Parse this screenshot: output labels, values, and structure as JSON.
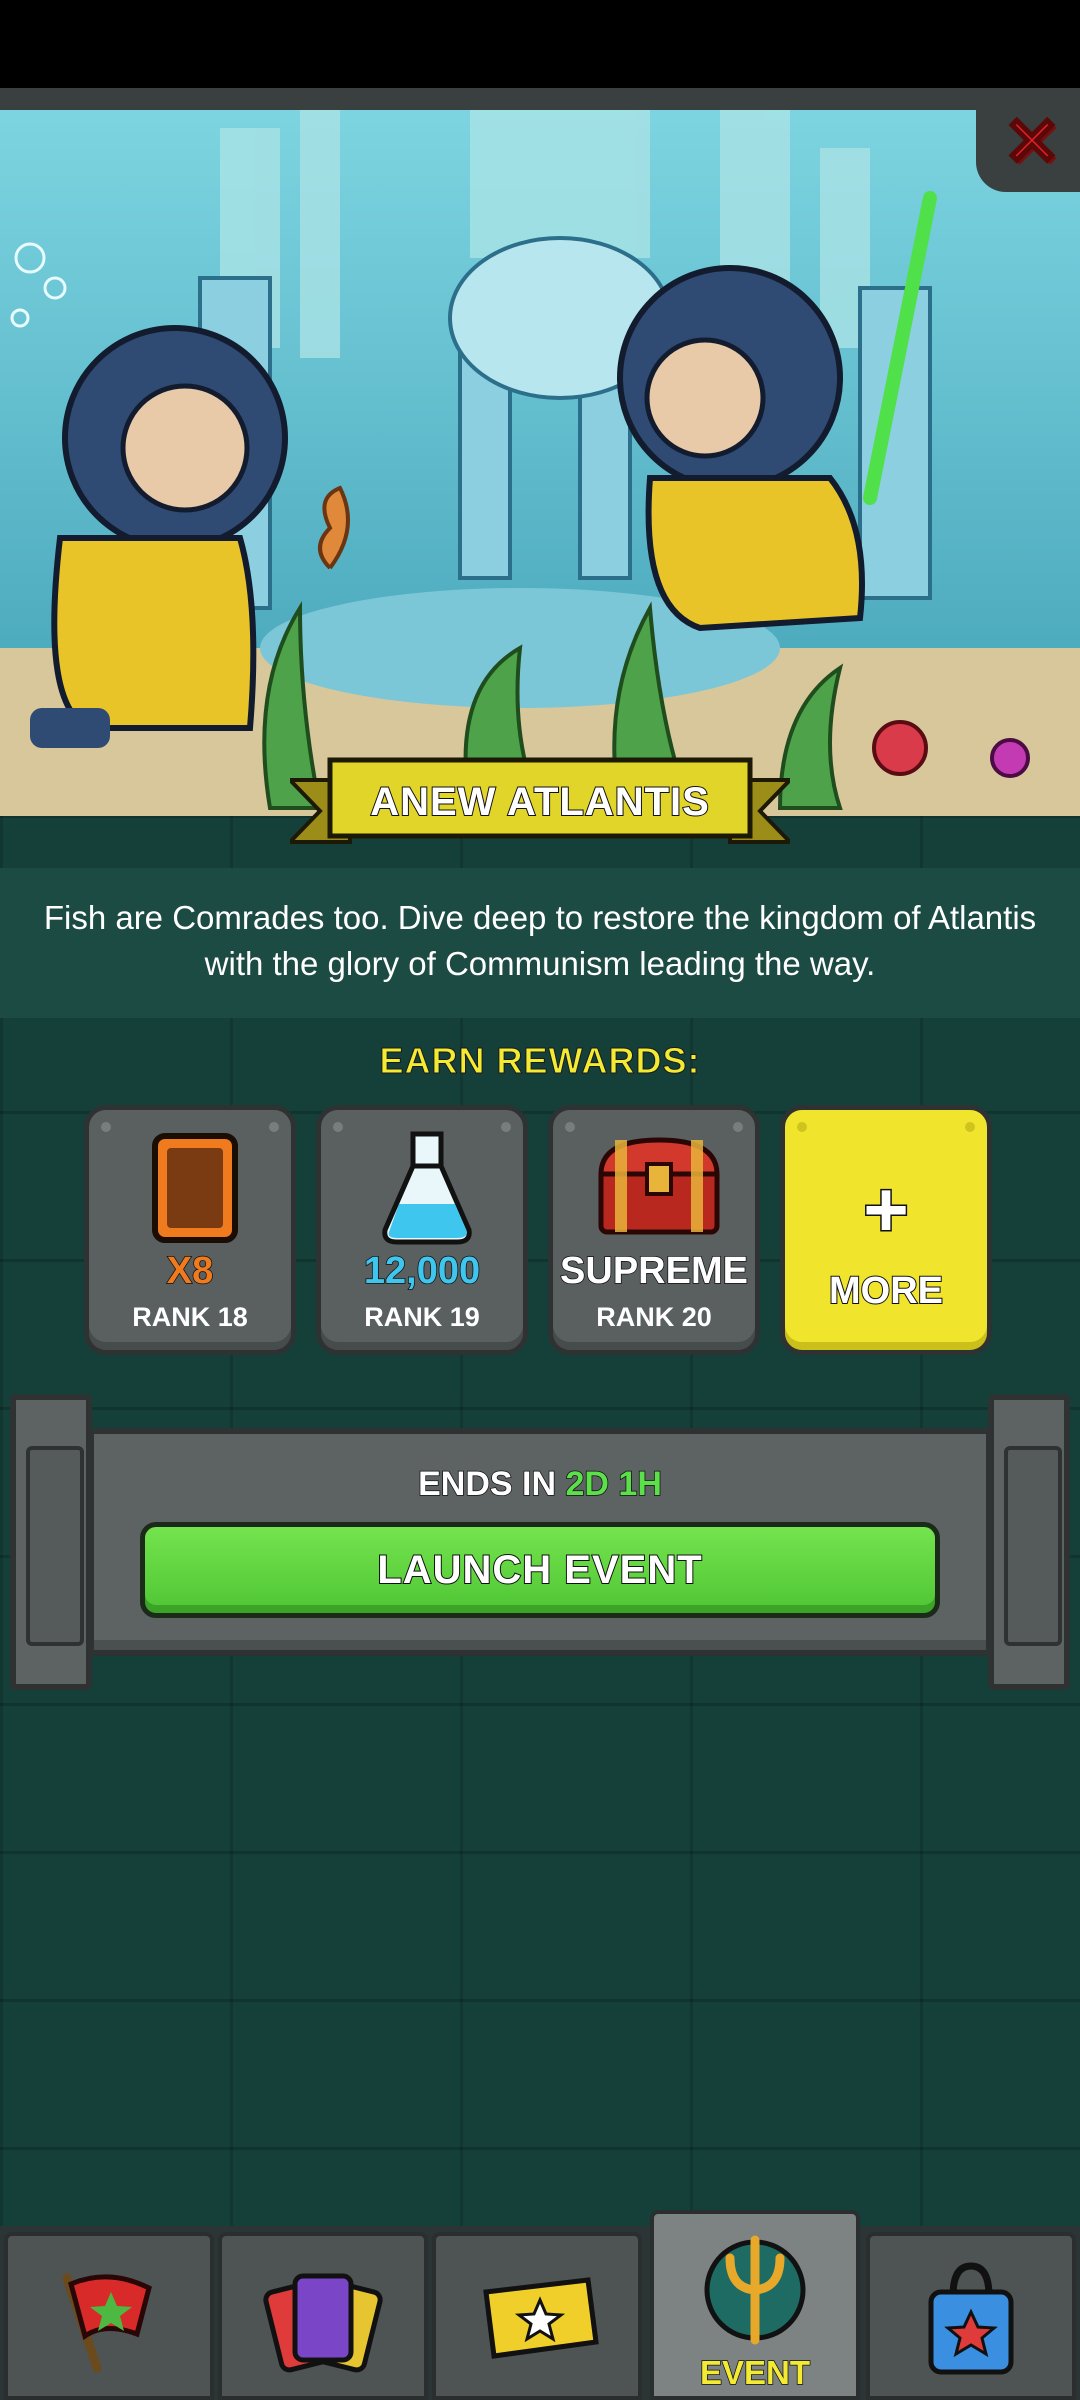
{
  "close": {
    "icon": "close-icon"
  },
  "event": {
    "title": "ANEW ATLANTIS",
    "description": "Fish are Comrades too. Dive deep to restore the kingdom of Atlantis with the glory of Communism leading the way."
  },
  "rewards": {
    "heading": "EARN REWARDS:",
    "items": [
      {
        "icon": "card-icon",
        "value": "X8",
        "rank": "RANK 18",
        "color": "#f07a1e"
      },
      {
        "icon": "flask-icon",
        "value": "12,000",
        "rank": "RANK 19",
        "color": "#3fc6ef"
      },
      {
        "icon": "treasure-chest-icon",
        "value": "SUPREME",
        "rank": "RANK 20",
        "color": "#ffffff"
      }
    ],
    "more": {
      "icon": "plus-icon",
      "label": "MORE"
    }
  },
  "timer": {
    "prefix": "ENDS IN",
    "time": "2D 1H"
  },
  "launch": {
    "label": "LAUNCH EVENT"
  },
  "tabs": [
    {
      "icon": "flag-icon",
      "label": ""
    },
    {
      "icon": "cards-icon",
      "label": ""
    },
    {
      "icon": "ticket-icon",
      "label": ""
    },
    {
      "icon": "trident-icon",
      "label": "EVENT",
      "active": true
    },
    {
      "icon": "shop-bag-icon",
      "label": ""
    }
  ],
  "colors": {
    "background": "#17453d",
    "accent_yellow": "#f3ea33",
    "launch_green": "#5fd43e",
    "close_red": "#e2202a"
  }
}
